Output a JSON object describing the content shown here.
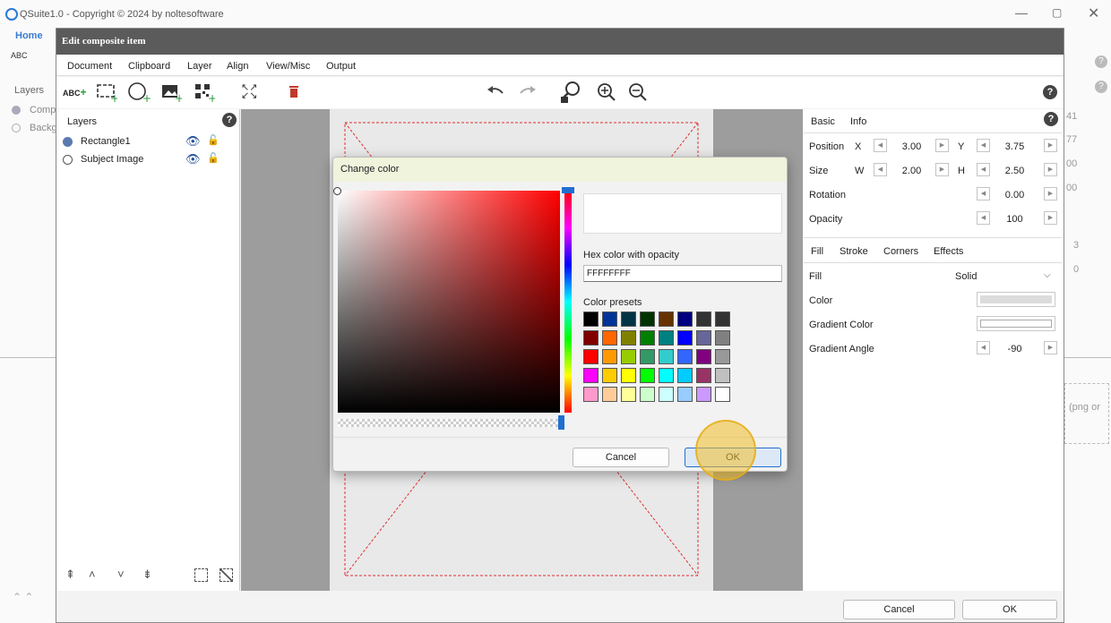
{
  "app": {
    "title": "QSuite1.0 - Copyright © 2024 by noltesoftware",
    "home_tab": "Home",
    "layers_label": "Layers",
    "layer_items": [
      "Comp",
      "Backg"
    ],
    "right_values": [
      "41",
      "77",
      "00",
      "00",
      "3",
      "0"
    ],
    "right_hint": "(png or"
  },
  "editor": {
    "title": "Edit composite item",
    "tabs": [
      "Document",
      "Clipboard",
      "Layer",
      "Align",
      "View/Misc",
      "Output"
    ],
    "cancel_label": "Cancel",
    "ok_label": "OK"
  },
  "layers_panel": {
    "title": "Layers",
    "items": [
      {
        "name": "Rectangle1",
        "selected": true
      },
      {
        "name": "Subject Image",
        "selected": false
      }
    ]
  },
  "props": {
    "tabs": [
      "Basic",
      "Info"
    ],
    "position_label": "Position",
    "x_label": "X",
    "x_value": "3.00",
    "y_label": "Y",
    "y_value": "3.75",
    "size_label": "Size",
    "w_label": "W",
    "w_value": "2.00",
    "h_label": "H",
    "h_value": "2.50",
    "rotation_label": "Rotation",
    "rotation_value": "0.00",
    "opacity_label": "Opacity",
    "opacity_value": "100",
    "fill_tabs": [
      "Fill",
      "Stroke",
      "Corners",
      "Effects"
    ],
    "fill_label": "Fill",
    "fill_value": "Solid",
    "color_label": "Color",
    "gradient_color_label": "Gradient Color",
    "gradient_angle_label": "Gradient Angle",
    "gradient_angle_value": "-90"
  },
  "color_dialog": {
    "title": "Change color",
    "hex_label": "Hex color with opacity",
    "hex_value": "FFFFFFFF",
    "presets_label": "Color presets",
    "cancel_label": "Cancel",
    "ok_label": "OK",
    "presets": [
      [
        "#000000",
        "#003399",
        "#003344",
        "#003300",
        "#663300",
        "#000080",
        "#333333",
        "#333333"
      ],
      [
        "#800000",
        "#ff6600",
        "#808000",
        "#008000",
        "#008080",
        "#0000ff",
        "#666699",
        "#808080"
      ],
      [
        "#ff0000",
        "#ff9900",
        "#99cc00",
        "#339966",
        "#33cccc",
        "#3366ff",
        "#800080",
        "#999999"
      ],
      [
        "#ff00ff",
        "#ffcc00",
        "#ffff00",
        "#00ff00",
        "#00ffff",
        "#00ccff",
        "#993366",
        "#c0c0c0"
      ],
      [
        "#ff99cc",
        "#ffcc99",
        "#ffff99",
        "#ccffcc",
        "#ccffff",
        "#99ccff",
        "#cc99ff",
        "#ffffff"
      ]
    ]
  }
}
